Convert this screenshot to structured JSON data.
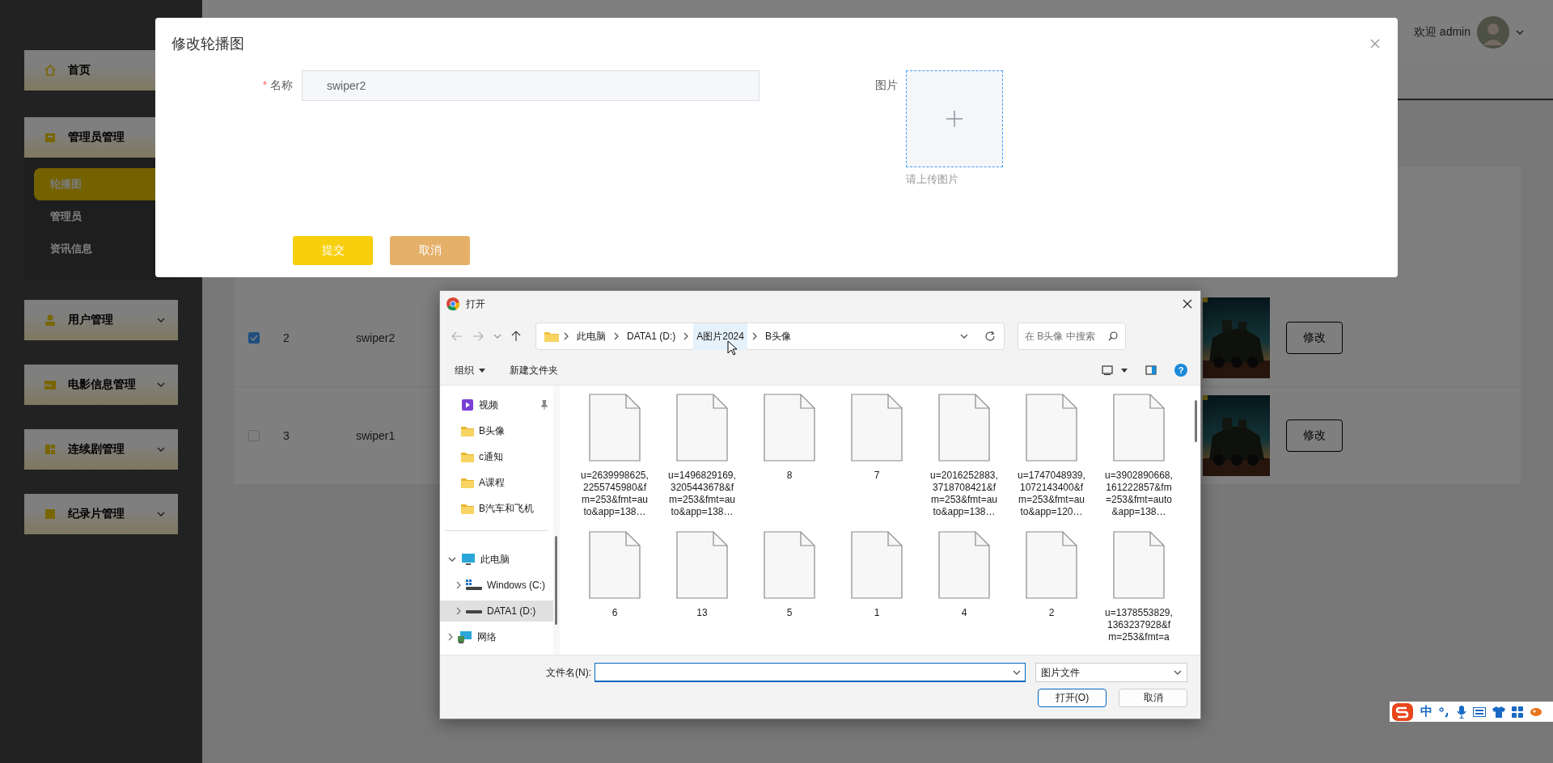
{
  "sidebar": {
    "items": [
      {
        "kind": "link",
        "label": "首页"
      },
      {
        "kind": "submenu",
        "label": "管理员管理",
        "expanded": true,
        "children": [
          {
            "label": "轮播图",
            "selected": true
          },
          {
            "label": "管理员",
            "selected": false
          },
          {
            "label": "资讯信息",
            "selected": false
          }
        ]
      },
      {
        "kind": "submenu",
        "label": "用户管理",
        "expanded": false
      },
      {
        "kind": "submenu",
        "label": "电影信息管理",
        "expanded": false
      },
      {
        "kind": "submenu",
        "label": "连续剧管理",
        "expanded": false
      },
      {
        "kind": "submenu",
        "label": "纪录片管理",
        "expanded": false
      }
    ]
  },
  "header": {
    "greeting": "欢迎 admin"
  },
  "table": {
    "rows": [
      {
        "checked": true,
        "id": "2",
        "name": "swiper2",
        "action": "修改"
      },
      {
        "checked": false,
        "id": "3",
        "name": "swiper1",
        "action": "修改"
      }
    ]
  },
  "modal": {
    "title": "修改轮播图",
    "field": {
      "label": "名称",
      "required_mark": "*",
      "value": "swiper2"
    },
    "upload": {
      "label": "图片",
      "hint": "请上传图片"
    },
    "buttons": [
      {
        "label": "提交",
        "kind": "primary"
      },
      {
        "label": "取消",
        "kind": "secondary"
      }
    ]
  },
  "file_dialog": {
    "title": "打开",
    "path": [
      {
        "label": "此电脑",
        "hovered": false
      },
      {
        "label": "DATA1 (D:)",
        "hovered": false
      },
      {
        "label": "A图片2024",
        "hovered": true
      },
      {
        "label": "B头像",
        "hovered": false
      }
    ],
    "search": {
      "placeholder": "在 B头像 中搜索"
    },
    "toolbar": {
      "organize": "组织",
      "new_folder": "新建文件夹",
      "help": "?"
    },
    "quick_access": [
      {
        "kind": "video",
        "label": "视频",
        "pinned": true
      },
      {
        "kind": "folder",
        "label": "B头像",
        "pinned": false
      },
      {
        "kind": "folder",
        "label": "c通知",
        "pinned": false
      },
      {
        "kind": "folder",
        "label": "A课程",
        "pinned": false
      },
      {
        "kind": "folder",
        "label": "B汽车和飞机",
        "pinned": false
      }
    ],
    "tree": [
      {
        "kind": "pc",
        "label": "此电脑",
        "expanded": true,
        "selected": false,
        "children": [
          {
            "kind": "system_drive",
            "label": "Windows (C:)",
            "expanded": false,
            "selected": false
          },
          {
            "kind": "drive",
            "label": "DATA1 (D:)",
            "expanded": false,
            "selected": true
          }
        ]
      },
      {
        "kind": "network",
        "label": "网络",
        "expanded": false,
        "selected": false
      }
    ],
    "files": [
      {
        "name": "u=2639998625,2255745980&fm=253&fmt=auto&app=138…"
      },
      {
        "name": "u=1496829169,3205443678&fm=253&fmt=auto&app=138…"
      },
      {
        "name": "8"
      },
      {
        "name": "7"
      },
      {
        "name": "u=2016252883,3718708421&fm=253&fmt=auto&app=138…"
      },
      {
        "name": "u=1747048939,1072143400&fm=253&fmt=auto&app=120…"
      },
      {
        "name": "u=3902890668,161222857&fm=253&fmt=auto&app=138…"
      },
      {
        "name": "6"
      },
      {
        "name": "13"
      },
      {
        "name": "5"
      },
      {
        "name": "1"
      },
      {
        "name": "4"
      },
      {
        "name": "2"
      },
      {
        "name": "u=1378553829,1363237928&fm=253&fmt=a"
      }
    ],
    "filename_label": "文件名(N):",
    "file_type": "图片文件",
    "buttons": [
      {
        "label": "打开(O)",
        "kind": "default"
      },
      {
        "label": "取消",
        "kind": "normal"
      }
    ]
  },
  "ime_toolbar": {
    "mode": "中"
  }
}
